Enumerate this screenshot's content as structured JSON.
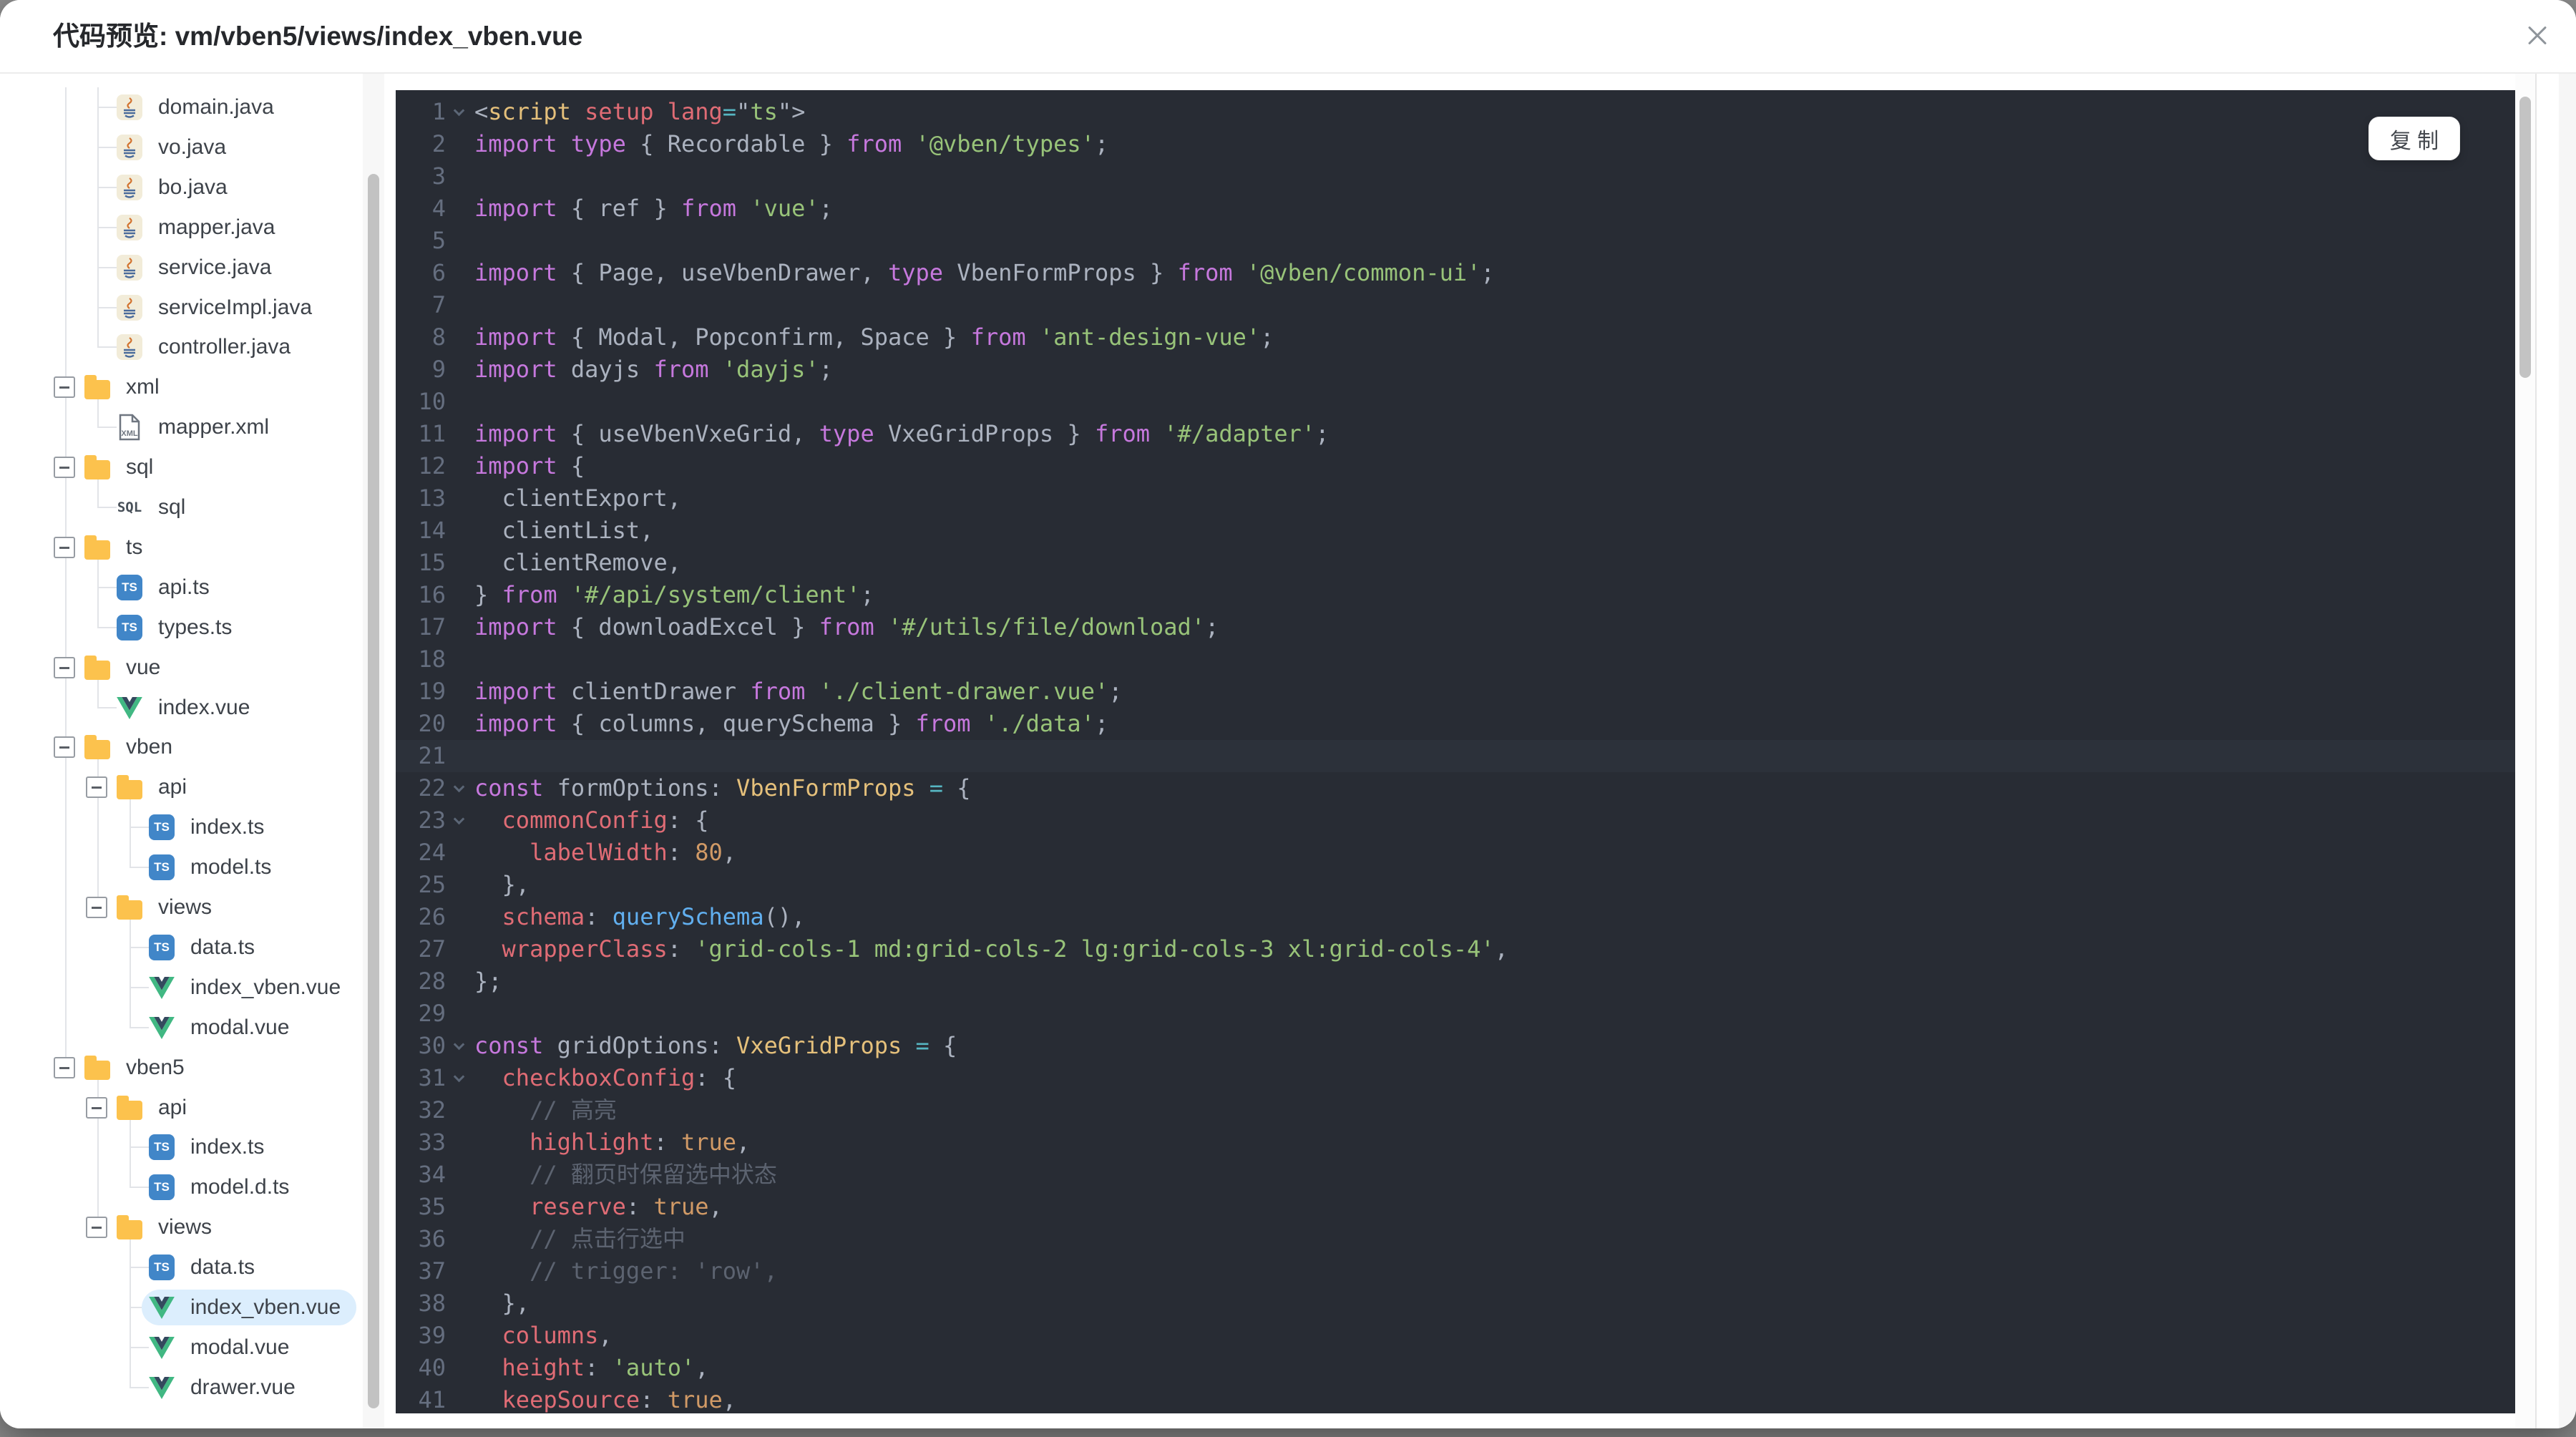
{
  "dialog": {
    "title": "代码预览: vm/vben5/views/index_vben.vue"
  },
  "editor": {
    "copy_label": "复 制",
    "current_line": 21,
    "fold_lines": [
      1,
      22,
      23,
      30,
      31
    ]
  },
  "palette": {
    "backdrop": "#8e8e8e",
    "editor_bg": "#282c34",
    "current_line_bg": "#2c313a",
    "selection_blue": "#dceefd",
    "folder_amber": "#fcc24d",
    "ts_blue": "#4186c8",
    "vue_green": "#41b883",
    "vue_dark": "#34495e",
    "keyword": "#c678dd",
    "string": "#98c379",
    "number": "#d19a66",
    "property": "#e06c75",
    "type": "#e5c07b",
    "function": "#61afef",
    "comment": "#5c6370",
    "operator": "#56b6c2",
    "default_text": "#abb2bf",
    "line_number": "#656e7f",
    "guide_line": "#e2e4e8"
  },
  "sidebar": {
    "rows": [
      {
        "label": "domain.java",
        "icon": "java",
        "kind": "file",
        "v": [
          0
        ],
        "elbowCol": 1,
        "last": false
      },
      {
        "label": "vo.java",
        "icon": "java",
        "kind": "file",
        "v": [
          0
        ],
        "elbowCol": 1,
        "last": false
      },
      {
        "label": "bo.java",
        "icon": "java",
        "kind": "file",
        "v": [
          0
        ],
        "elbowCol": 1,
        "last": false
      },
      {
        "label": "mapper.java",
        "icon": "java",
        "kind": "file",
        "v": [
          0
        ],
        "elbowCol": 1,
        "last": false
      },
      {
        "label": "service.java",
        "icon": "java",
        "kind": "file",
        "v": [
          0
        ],
        "elbowCol": 1,
        "last": false
      },
      {
        "label": "serviceImpl.java",
        "icon": "java",
        "kind": "file",
        "v": [
          0
        ],
        "elbowCol": 1,
        "last": false
      },
      {
        "label": "controller.java",
        "icon": "java",
        "kind": "file",
        "v": [
          0
        ],
        "elbowCol": 1,
        "last": true
      },
      {
        "label": "xml",
        "icon": "folder",
        "kind": "folder",
        "boxCol": 0,
        "v": [
          0
        ],
        "stub": [
          1
        ]
      },
      {
        "label": "mapper.xml",
        "icon": "xml",
        "kind": "file",
        "v": [
          0
        ],
        "elbowCol": 1,
        "last": true
      },
      {
        "label": "sql",
        "icon": "folder",
        "kind": "folder",
        "boxCol": 0,
        "v": [
          0
        ],
        "stub": [
          1
        ]
      },
      {
        "label": "sql",
        "icon": "sql",
        "kind": "file",
        "v": [
          0
        ],
        "elbowCol": 1,
        "last": true
      },
      {
        "label": "ts",
        "icon": "folder",
        "kind": "folder",
        "boxCol": 0,
        "v": [
          0
        ],
        "stub": [
          1
        ]
      },
      {
        "label": "api.ts",
        "icon": "ts",
        "kind": "file",
        "v": [
          0
        ],
        "elbowCol": 1,
        "last": false
      },
      {
        "label": "types.ts",
        "icon": "ts",
        "kind": "file",
        "v": [
          0
        ],
        "elbowCol": 1,
        "last": true
      },
      {
        "label": "vue",
        "icon": "folder",
        "kind": "folder",
        "boxCol": 0,
        "v": [
          0
        ],
        "stub": [
          1
        ]
      },
      {
        "label": "index.vue",
        "icon": "vue",
        "kind": "file",
        "v": [
          0
        ],
        "elbowCol": 1,
        "last": true
      },
      {
        "label": "vben",
        "icon": "folder",
        "kind": "folder",
        "boxCol": 0,
        "v": [
          0
        ],
        "stub": [
          1
        ]
      },
      {
        "label": "api",
        "icon": "folder",
        "kind": "folder",
        "boxCol": 1,
        "v": [
          0,
          1
        ],
        "stub": [
          2
        ]
      },
      {
        "label": "index.ts",
        "icon": "ts",
        "kind": "file",
        "v": [
          0,
          1
        ],
        "elbowCol": 2,
        "last": false
      },
      {
        "label": "model.ts",
        "icon": "ts",
        "kind": "file",
        "v": [
          0,
          1
        ],
        "elbowCol": 2,
        "last": true
      },
      {
        "label": "views",
        "icon": "folder",
        "kind": "folder",
        "boxCol": 1,
        "v": [
          0
        ],
        "vhalf": [
          1
        ],
        "stub": [
          2
        ]
      },
      {
        "label": "data.ts",
        "icon": "ts",
        "kind": "file",
        "v": [
          0
        ],
        "elbowCol": 2,
        "last": false
      },
      {
        "label": "index_vben.vue",
        "icon": "vue",
        "kind": "file",
        "v": [
          0
        ],
        "elbowCol": 2,
        "last": false
      },
      {
        "label": "modal.vue",
        "icon": "vue",
        "kind": "file",
        "v": [
          0
        ],
        "elbowCol": 2,
        "last": true
      },
      {
        "label": "vben5",
        "icon": "folder",
        "kind": "folder",
        "boxCol": 0,
        "vhalf": [
          0
        ],
        "stub": [
          1
        ]
      },
      {
        "label": "api",
        "icon": "folder",
        "kind": "folder",
        "boxCol": 1,
        "v": [
          1
        ],
        "stub": [
          2
        ]
      },
      {
        "label": "index.ts",
        "icon": "ts",
        "kind": "file",
        "v": [
          1
        ],
        "elbowCol": 2,
        "last": false
      },
      {
        "label": "model.d.ts",
        "icon": "ts",
        "kind": "file",
        "v": [
          1
        ],
        "elbowCol": 2,
        "last": true
      },
      {
        "label": "views",
        "icon": "folder",
        "kind": "folder",
        "boxCol": 1,
        "vhalf": [
          1
        ],
        "stub": [
          2
        ]
      },
      {
        "label": "data.ts",
        "icon": "ts",
        "kind": "file",
        "elbowCol": 2,
        "last": false
      },
      {
        "label": "index_vben.vue",
        "icon": "vue",
        "kind": "file",
        "elbowCol": 2,
        "last": false,
        "selected": true
      },
      {
        "label": "modal.vue",
        "icon": "vue",
        "kind": "file",
        "elbowCol": 2,
        "last": false
      },
      {
        "label": "drawer.vue",
        "icon": "vue",
        "kind": "file",
        "elbowCol": 2,
        "last": true
      }
    ]
  },
  "code": {
    "lines": [
      {
        "n": 1,
        "seg": [
          [
            "pu",
            "<"
          ],
          [
            "ty",
            "script"
          ],
          [
            "pu",
            " "
          ],
          [
            "pr",
            "setup"
          ],
          [
            "pu",
            " "
          ],
          [
            "pr",
            "lang"
          ],
          [
            "op",
            "="
          ],
          [
            "pu",
            "\""
          ],
          [
            "st",
            "ts"
          ],
          [
            "pu",
            "\""
          ],
          [
            "pu",
            ">"
          ]
        ]
      },
      {
        "n": 2,
        "seg": [
          [
            "kw",
            "import type"
          ],
          [
            "pu",
            " { Recordable } "
          ],
          [
            "kw",
            "from"
          ],
          [
            "pu",
            " "
          ],
          [
            "st",
            "'@vben/types'"
          ],
          [
            "pu",
            ";"
          ]
        ]
      },
      {
        "n": 3,
        "seg": []
      },
      {
        "n": 4,
        "seg": [
          [
            "kw",
            "import"
          ],
          [
            "pu",
            " { ref } "
          ],
          [
            "kw",
            "from"
          ],
          [
            "pu",
            " "
          ],
          [
            "st",
            "'vue'"
          ],
          [
            "pu",
            ";"
          ]
        ]
      },
      {
        "n": 5,
        "seg": []
      },
      {
        "n": 6,
        "seg": [
          [
            "kw",
            "import"
          ],
          [
            "pu",
            " { Page, useVbenDrawer, "
          ],
          [
            "kw",
            "type"
          ],
          [
            "pu",
            " VbenFormProps } "
          ],
          [
            "kw",
            "from"
          ],
          [
            "pu",
            " "
          ],
          [
            "st",
            "'@vben/common-ui'"
          ],
          [
            "pu",
            ";"
          ]
        ]
      },
      {
        "n": 7,
        "seg": []
      },
      {
        "n": 8,
        "seg": [
          [
            "kw",
            "import"
          ],
          [
            "pu",
            " { Modal, Popconfirm, Space } "
          ],
          [
            "kw",
            "from"
          ],
          [
            "pu",
            " "
          ],
          [
            "st",
            "'ant-design-vue'"
          ],
          [
            "pu",
            ";"
          ]
        ]
      },
      {
        "n": 9,
        "seg": [
          [
            "kw",
            "import"
          ],
          [
            "pu",
            " dayjs "
          ],
          [
            "kw",
            "from"
          ],
          [
            "pu",
            " "
          ],
          [
            "st",
            "'dayjs'"
          ],
          [
            "pu",
            ";"
          ]
        ]
      },
      {
        "n": 10,
        "seg": []
      },
      {
        "n": 11,
        "seg": [
          [
            "kw",
            "import"
          ],
          [
            "pu",
            " { useVbenVxeGrid, "
          ],
          [
            "kw",
            "type"
          ],
          [
            "pu",
            " VxeGridProps } "
          ],
          [
            "kw",
            "from"
          ],
          [
            "pu",
            " "
          ],
          [
            "st",
            "'#/adapter'"
          ],
          [
            "pu",
            ";"
          ]
        ]
      },
      {
        "n": 12,
        "seg": [
          [
            "kw",
            "import"
          ],
          [
            "pu",
            " {"
          ]
        ]
      },
      {
        "n": 13,
        "seg": [
          [
            "pu",
            "  clientExport,"
          ]
        ]
      },
      {
        "n": 14,
        "seg": [
          [
            "pu",
            "  clientList,"
          ]
        ]
      },
      {
        "n": 15,
        "seg": [
          [
            "pu",
            "  clientRemove,"
          ]
        ]
      },
      {
        "n": 16,
        "seg": [
          [
            "pu",
            "} "
          ],
          [
            "kw",
            "from"
          ],
          [
            "pu",
            " "
          ],
          [
            "st",
            "'#/api/system/client'"
          ],
          [
            "pu",
            ";"
          ]
        ]
      },
      {
        "n": 17,
        "seg": [
          [
            "kw",
            "import"
          ],
          [
            "pu",
            " { downloadExcel } "
          ],
          [
            "kw",
            "from"
          ],
          [
            "pu",
            " "
          ],
          [
            "st",
            "'#/utils/file/download'"
          ],
          [
            "pu",
            ";"
          ]
        ]
      },
      {
        "n": 18,
        "seg": []
      },
      {
        "n": 19,
        "seg": [
          [
            "kw",
            "import"
          ],
          [
            "pu",
            " clientDrawer "
          ],
          [
            "kw",
            "from"
          ],
          [
            "pu",
            " "
          ],
          [
            "st",
            "'./client-drawer.vue'"
          ],
          [
            "pu",
            ";"
          ]
        ]
      },
      {
        "n": 20,
        "seg": [
          [
            "kw",
            "import"
          ],
          [
            "pu",
            " { columns, querySchema } "
          ],
          [
            "kw",
            "from"
          ],
          [
            "pu",
            " "
          ],
          [
            "st",
            "'./data'"
          ],
          [
            "pu",
            ";"
          ]
        ]
      },
      {
        "n": 21,
        "seg": []
      },
      {
        "n": 22,
        "seg": [
          [
            "kw",
            "const"
          ],
          [
            "pu",
            " formOptions: "
          ],
          [
            "ty",
            "VbenFormProps"
          ],
          [
            "pu",
            " "
          ],
          [
            "op",
            "="
          ],
          [
            "pu",
            " {"
          ]
        ]
      },
      {
        "n": 23,
        "seg": [
          [
            "pu",
            "  "
          ],
          [
            "pr",
            "commonConfig"
          ],
          [
            "pu",
            ": {"
          ]
        ]
      },
      {
        "n": 24,
        "seg": [
          [
            "pu",
            "    "
          ],
          [
            "pr",
            "labelWidth"
          ],
          [
            "pu",
            ": "
          ],
          [
            "nu",
            "80"
          ],
          [
            "pu",
            ","
          ]
        ]
      },
      {
        "n": 25,
        "seg": [
          [
            "pu",
            "  },"
          ]
        ]
      },
      {
        "n": 26,
        "seg": [
          [
            "pu",
            "  "
          ],
          [
            "pr",
            "schema"
          ],
          [
            "pu",
            ": "
          ],
          [
            "fn",
            "querySchema"
          ],
          [
            "pu",
            "(),"
          ]
        ]
      },
      {
        "n": 27,
        "seg": [
          [
            "pu",
            "  "
          ],
          [
            "pr",
            "wrapperClass"
          ],
          [
            "pu",
            ": "
          ],
          [
            "st",
            "'grid-cols-1 md:grid-cols-2 lg:grid-cols-3 xl:grid-cols-4'"
          ],
          [
            "pu",
            ","
          ]
        ]
      },
      {
        "n": 28,
        "seg": [
          [
            "pu",
            "};"
          ]
        ]
      },
      {
        "n": 29,
        "seg": []
      },
      {
        "n": 30,
        "seg": [
          [
            "kw",
            "const"
          ],
          [
            "pu",
            " gridOptions: "
          ],
          [
            "ty",
            "VxeGridProps"
          ],
          [
            "pu",
            " "
          ],
          [
            "op",
            "="
          ],
          [
            "pu",
            " {"
          ]
        ]
      },
      {
        "n": 31,
        "seg": [
          [
            "pu",
            "  "
          ],
          [
            "pr",
            "checkboxConfig"
          ],
          [
            "pu",
            ": {"
          ]
        ]
      },
      {
        "n": 32,
        "seg": [
          [
            "pu",
            "    "
          ],
          [
            "cm",
            "// 高亮"
          ]
        ]
      },
      {
        "n": 33,
        "seg": [
          [
            "pu",
            "    "
          ],
          [
            "pr",
            "highlight"
          ],
          [
            "pu",
            ": "
          ],
          [
            "nu",
            "true"
          ],
          [
            "pu",
            ","
          ]
        ]
      },
      {
        "n": 34,
        "seg": [
          [
            "pu",
            "    "
          ],
          [
            "cm",
            "// 翻页时保留选中状态"
          ]
        ]
      },
      {
        "n": 35,
        "seg": [
          [
            "pu",
            "    "
          ],
          [
            "pr",
            "reserve"
          ],
          [
            "pu",
            ": "
          ],
          [
            "nu",
            "true"
          ],
          [
            "pu",
            ","
          ]
        ]
      },
      {
        "n": 36,
        "seg": [
          [
            "pu",
            "    "
          ],
          [
            "cm",
            "// 点击行选中"
          ]
        ]
      },
      {
        "n": 37,
        "seg": [
          [
            "pu",
            "    "
          ],
          [
            "cm",
            "// trigger: 'row',"
          ]
        ]
      },
      {
        "n": 38,
        "seg": [
          [
            "pu",
            "  },"
          ]
        ]
      },
      {
        "n": 39,
        "seg": [
          [
            "pu",
            "  "
          ],
          [
            "pr",
            "columns"
          ],
          [
            "pu",
            ","
          ]
        ]
      },
      {
        "n": 40,
        "seg": [
          [
            "pu",
            "  "
          ],
          [
            "pr",
            "height"
          ],
          [
            "pu",
            ": "
          ],
          [
            "st",
            "'auto'"
          ],
          [
            "pu",
            ","
          ]
        ]
      },
      {
        "n": 41,
        "seg": [
          [
            "pu",
            "  "
          ],
          [
            "pr",
            "keepSource"
          ],
          [
            "pu",
            ": "
          ],
          [
            "nu",
            "true"
          ],
          [
            "pu",
            ","
          ]
        ]
      }
    ]
  }
}
